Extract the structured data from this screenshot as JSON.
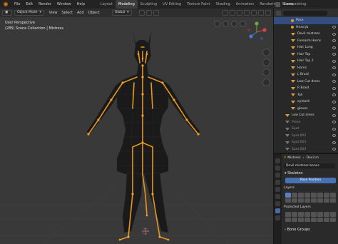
{
  "topbar": {
    "menu": [
      "File",
      "Edit",
      "Render",
      "Window",
      "Help"
    ],
    "workspaces": [
      "Layout",
      "Modeling",
      "Sculpting",
      "UV Editing",
      "Texture Paint",
      "Shading",
      "Animation",
      "Rendering",
      "Compositing"
    ],
    "active_workspace": "Modeling",
    "scene_label": "Scene"
  },
  "viewport": {
    "mode": "Object Mode",
    "menu": [
      "View",
      "Select",
      "Add",
      "Object"
    ],
    "transform": "Global",
    "perspective_label": "User Perspective",
    "collection_label": "(285) Scene Collection | Mistress",
    "figure_color": "#e8951e",
    "background": "#393939"
  },
  "outliner": {
    "rows": [
      {
        "label": "Pose",
        "selected": true,
        "kind": "head"
      },
      {
        "label": "Head.jb",
        "kind": "bone"
      },
      {
        "label": "Devil mistress",
        "kind": "tri"
      },
      {
        "label": "Forearm Horns",
        "kind": "tri"
      },
      {
        "label": "Hair Long",
        "kind": "tri"
      },
      {
        "label": "Hair Top",
        "kind": "tri"
      },
      {
        "label": "Hair Top 2",
        "kind": "tri"
      },
      {
        "label": "Horns",
        "kind": "tri"
      },
      {
        "label": "L Braid",
        "kind": "tri"
      },
      {
        "label": "Low Cut dress",
        "kind": "tri"
      },
      {
        "label": "R Braid",
        "kind": "tri"
      },
      {
        "label": "Tail",
        "kind": "tri"
      },
      {
        "label": "eyelash",
        "kind": "tri"
      },
      {
        "label": "gloves",
        "kind": "tri"
      },
      {
        "label": "Low Cut dress",
        "kind": "tri"
      },
      {
        "label": "Plane",
        "kind": "dim"
      },
      {
        "label": "Spot",
        "kind": "dim"
      },
      {
        "label": "Spot.002",
        "kind": "dim"
      },
      {
        "label": "Spot.003",
        "kind": "dim"
      },
      {
        "label": "Spot.004",
        "kind": "dim"
      }
    ]
  },
  "properties": {
    "object_name": "Mistress",
    "object_name_2": "Devil m",
    "armature_name": "Devil mistress bones",
    "section_skeleton": "Skeleton",
    "pose_position": "Pose Position",
    "layers_label": "Layers",
    "protected_layers_label": "Protected Layers",
    "section_bone_groups": "Bone Groups"
  }
}
